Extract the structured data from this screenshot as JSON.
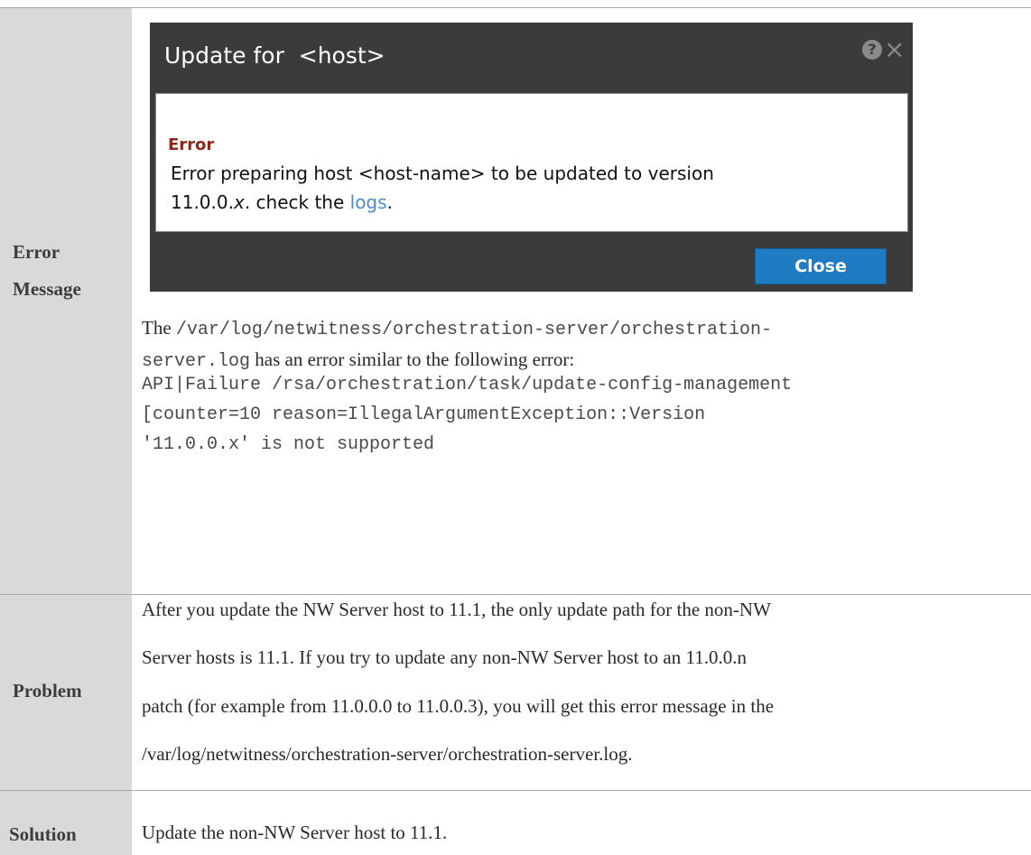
{
  "rows": {
    "error_message": {
      "label_line1": "Error",
      "label_line2": "Message"
    },
    "problem": {
      "label": "Problem",
      "text_lines": [
        "After you update the NW Server host to 11.1, the only update path for the non-NW",
        "Server hosts is 11.1. If you try to update any non-NW Server host to an 11.0.0.n",
        "patch (for example from 11.0.0.0 to 11.0.0.3), you will get this error message in the",
        "/var/log/netwitness/orchestration-server/orchestration-server.log."
      ]
    },
    "solution": {
      "label": "Solution",
      "text": "Update the non-NW Server host to 11.1."
    }
  },
  "dialog": {
    "title": "Update for  <host>",
    "help_glyph": "?",
    "close_glyph": "×",
    "error_heading": "Error",
    "message_part1": "Error preparing host <host-name> to be updated to version",
    "message_part2_prefix": "11.0.0.",
    "message_part2_italic": "x",
    "message_part2_mid": ". check the ",
    "message_link": "logs",
    "message_end": ".",
    "close_button": "Close"
  },
  "description": {
    "prefix": "The ",
    "log_path_line1": "/var/log/netwitness/orchestration-server/orchestration-",
    "log_path_line2": "server.log",
    "suffix": " has an error similar to the following error:"
  },
  "code_lines": [
    "API|Failure /rsa/orchestration/task/update-config-management",
    "[counter=10 reason=IllegalArgumentException::Version",
    "'11.0.0.x' is not supported"
  ]
}
